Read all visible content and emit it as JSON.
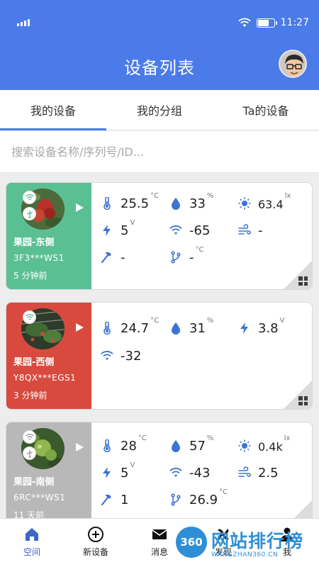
{
  "status_bar": {
    "time": "11:27",
    "signal_icon": "signal-icon",
    "wifi_icon": "wifi-icon",
    "battery_icon": "battery-icon"
  },
  "header": {
    "title": "设备列表",
    "avatar_icon": "avatar"
  },
  "tabs": [
    {
      "label": "我的设备",
      "active": true
    },
    {
      "label": "我的分组",
      "active": false
    },
    {
      "label": "Ta的设备",
      "active": false
    }
  ],
  "search": {
    "placeholder": "搜索设备名称/序列号/ID..."
  },
  "colors": {
    "header": "#4a7be8",
    "card_green": "#5bbf94",
    "card_red": "#d84a3e",
    "card_gray": "#b8b8b8",
    "icon_blue": "#3e73d6"
  },
  "devices": [
    {
      "name": "果园-东侧",
      "serial": "3F3***WS1",
      "updated": "5 分钟前",
      "status_color": "#5bbf94",
      "metrics": {
        "temperature": {
          "value": "25.5",
          "unit": "°C"
        },
        "humidity": {
          "value": "33",
          "unit": "%"
        },
        "light": {
          "value": "63.4",
          "unit": "lx"
        },
        "voltage": {
          "value": "5",
          "unit": "V"
        },
        "signal": {
          "value": "-65"
        },
        "wind": {
          "value": "-"
        },
        "hammer": {
          "value": "-"
        },
        "branch_temp": {
          "value": "-",
          "unit": "°C"
        }
      }
    },
    {
      "name": "果园-西侧",
      "serial": "Y8QX***EGS1",
      "updated": "3 分钟前",
      "status_color": "#d84a3e",
      "metrics": {
        "temperature": {
          "value": "24.7",
          "unit": "°C"
        },
        "humidity": {
          "value": "31",
          "unit": "%"
        },
        "voltage": {
          "value": "3.8",
          "unit": "V"
        },
        "signal": {
          "value": "-32"
        }
      }
    },
    {
      "name": "果园-南侧",
      "serial": "6RC***WS1",
      "updated": "11 天前",
      "status_color": "#b8b8b8",
      "metrics": {
        "temperature": {
          "value": "28",
          "unit": "°C"
        },
        "humidity": {
          "value": "57",
          "unit": "%"
        },
        "light": {
          "value": "0.4k",
          "unit": "lx"
        },
        "voltage": {
          "value": "5",
          "unit": "V"
        },
        "signal": {
          "value": "-43"
        },
        "wind": {
          "value": "2.5"
        },
        "hammer": {
          "value": "1"
        },
        "branch_temp": {
          "value": "26.9",
          "unit": "°C"
        }
      }
    }
  ],
  "bottom_nav": [
    {
      "label": "空间",
      "icon": "home-icon",
      "active": true
    },
    {
      "label": "新设备",
      "icon": "add-circle-icon",
      "active": false
    },
    {
      "label": "消息",
      "icon": "mail-icon",
      "active": false
    },
    {
      "label": "发现",
      "icon": "discover-icon",
      "active": false
    },
    {
      "label": "我",
      "icon": "user-icon",
      "active": false
    }
  ],
  "watermark": {
    "badge": "360",
    "text": "网站排行榜",
    "sub": "WANGZHAN360.CN"
  }
}
